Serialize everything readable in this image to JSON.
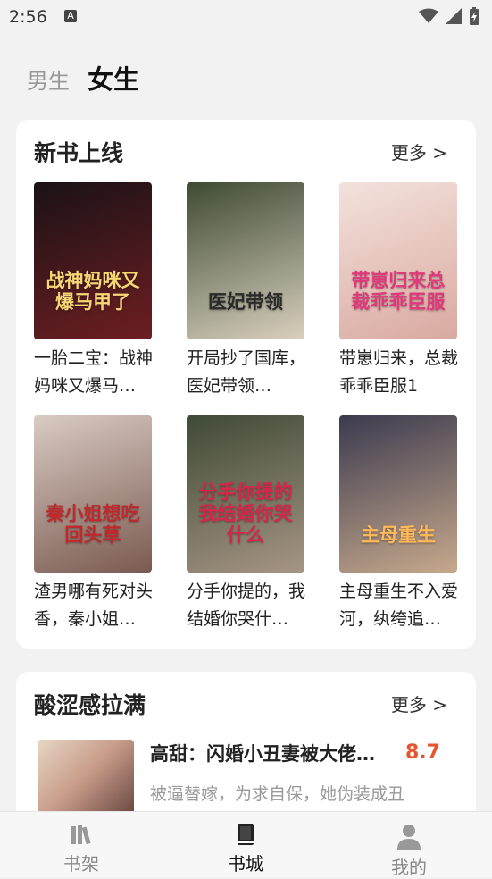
{
  "status": {
    "time": "2:56",
    "a_icon": "A"
  },
  "tabs": {
    "male": "男生",
    "female": "女生"
  },
  "section1": {
    "title": "新书上线",
    "more": "更多 >",
    "books": [
      {
        "title": "一胎二宝：战神妈咪又爆马…",
        "cover_text": "战神妈咪又爆马甲了",
        "cover_colors": [
          "#1a1216",
          "#6e1e22"
        ],
        "cover_text_color": "#f6d774"
      },
      {
        "title": "开局抄了国库，医妃带领…",
        "cover_text": "医妃带领",
        "cover_colors": [
          "#3e4a35",
          "#d8d0bd"
        ],
        "cover_text_color": "#2a2a2a"
      },
      {
        "title": "带崽归来，总裁乖乖臣服1",
        "cover_text": "带崽归来总裁乖乖臣服",
        "cover_colors": [
          "#f3e2dc",
          "#d9a9a0"
        ],
        "cover_text_color": "#e0387a"
      },
      {
        "title": "渣男哪有死对头香，秦小姐…",
        "cover_text": "秦小姐想吃回头草",
        "cover_colors": [
          "#d9cbc3",
          "#7a5a50"
        ],
        "cover_text_color": "#c0282c"
      },
      {
        "title": "分手你提的，我结婚你哭什…",
        "cover_text": "分手你提的我结婚你哭什么",
        "cover_colors": [
          "#3e4a36",
          "#a79584"
        ],
        "cover_text_color": "#d8254a"
      },
      {
        "title": "主母重生不入爱河，纨绔追…",
        "cover_text": "主母重生",
        "cover_colors": [
          "#3b3a4f",
          "#c7a98c"
        ],
        "cover_text_color": "#ffb85a"
      }
    ]
  },
  "section2": {
    "title": "酸涩感拉满",
    "more": "更多 >",
    "item": {
      "title": "高甜：闪婚小丑妻被大佬…",
      "score": "8.7",
      "desc": "被逼替嫁，为求自保，她伪装成丑"
    }
  },
  "nav": [
    {
      "label": "书架",
      "icon": "bookshelf-icon"
    },
    {
      "label": "书城",
      "icon": "book-icon"
    },
    {
      "label": "我的",
      "icon": "person-icon"
    }
  ]
}
